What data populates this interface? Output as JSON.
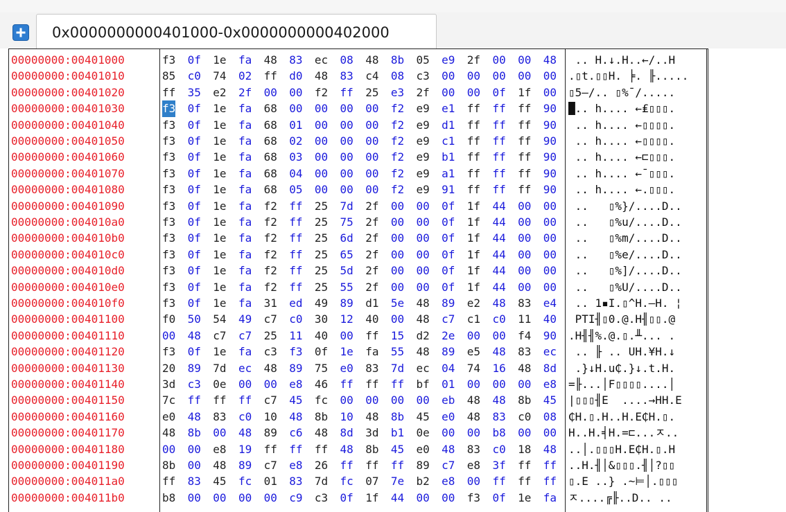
{
  "tabs": {
    "add_button_icon": "plus-icon",
    "active_label": "0x0000000000401000-0x0000000000402000"
  },
  "hex_view": {
    "selected": {
      "row": 3,
      "col": 0
    },
    "colors": {
      "address": "#e8202a",
      "zero_byte": "#1a1adc",
      "byte": "#222222",
      "selection": "#2f7fc9"
    },
    "rows": [
      {
        "address": "00000000:00401000",
        "bytes": [
          "f3",
          "0f",
          "1e",
          "fa",
          "48",
          "83",
          "ec",
          "08",
          "48",
          "8b",
          "05",
          "e9",
          "2f",
          "00",
          "00",
          "48"
        ],
        "ascii": " .. H.↓.H..←/..H"
      },
      {
        "address": "00000000:00401010",
        "bytes": [
          "85",
          "c0",
          "74",
          "02",
          "ff",
          "d0",
          "48",
          "83",
          "c4",
          "08",
          "c3",
          "00",
          "00",
          "00",
          "00",
          "00"
        ],
        "ascii": ".▯t.▯▯H. ╞. ╟....."
      },
      {
        "address": "00000000:00401020",
        "bytes": [
          "ff",
          "35",
          "e2",
          "2f",
          "00",
          "00",
          "f2",
          "ff",
          "25",
          "e3",
          "2f",
          "00",
          "00",
          "0f",
          "1f",
          "00"
        ],
        "ascii": "▯5–/.. ▯%¯/....."
      },
      {
        "address": "00000000:00401030",
        "bytes": [
          "f3",
          "0f",
          "1e",
          "fa",
          "68",
          "00",
          "00",
          "00",
          "00",
          "f2",
          "e9",
          "e1",
          "ff",
          "ff",
          "ff",
          "90"
        ],
        "ascii": "█.. h.... ←₤▯▯▯."
      },
      {
        "address": "00000000:00401040",
        "bytes": [
          "f3",
          "0f",
          "1e",
          "fa",
          "68",
          "01",
          "00",
          "00",
          "00",
          "f2",
          "e9",
          "d1",
          "ff",
          "ff",
          "ff",
          "90"
        ],
        "ascii": " .. h.... ←▯▯▯▯."
      },
      {
        "address": "00000000:00401050",
        "bytes": [
          "f3",
          "0f",
          "1e",
          "fa",
          "68",
          "02",
          "00",
          "00",
          "00",
          "f2",
          "e9",
          "c1",
          "ff",
          "ff",
          "ff",
          "90"
        ],
        "ascii": " .. h.... ←▯▯▯▯."
      },
      {
        "address": "00000000:00401060",
        "bytes": [
          "f3",
          "0f",
          "1e",
          "fa",
          "68",
          "03",
          "00",
          "00",
          "00",
          "f2",
          "e9",
          "b1",
          "ff",
          "ff",
          "ff",
          "90"
        ],
        "ascii": " .. h.... ←⊏▯▯▯."
      },
      {
        "address": "00000000:00401070",
        "bytes": [
          "f3",
          "0f",
          "1e",
          "fa",
          "68",
          "04",
          "00",
          "00",
          "00",
          "f2",
          "e9",
          "a1",
          "ff",
          "ff",
          "ff",
          "90"
        ],
        "ascii": " .. h.... ←¯▯▯▯."
      },
      {
        "address": "00000000:00401080",
        "bytes": [
          "f3",
          "0f",
          "1e",
          "fa",
          "68",
          "05",
          "00",
          "00",
          "00",
          "f2",
          "e9",
          "91",
          "ff",
          "ff",
          "ff",
          "90"
        ],
        "ascii": " .. h.... ←.▯▯▯."
      },
      {
        "address": "00000000:00401090",
        "bytes": [
          "f3",
          "0f",
          "1e",
          "fa",
          "f2",
          "ff",
          "25",
          "7d",
          "2f",
          "00",
          "00",
          "0f",
          "1f",
          "44",
          "00",
          "00"
        ],
        "ascii": " ..   ▯%}/....D.."
      },
      {
        "address": "00000000:004010a0",
        "bytes": [
          "f3",
          "0f",
          "1e",
          "fa",
          "f2",
          "ff",
          "25",
          "75",
          "2f",
          "00",
          "00",
          "0f",
          "1f",
          "44",
          "00",
          "00"
        ],
        "ascii": " ..   ▯%u/....D.."
      },
      {
        "address": "00000000:004010b0",
        "bytes": [
          "f3",
          "0f",
          "1e",
          "fa",
          "f2",
          "ff",
          "25",
          "6d",
          "2f",
          "00",
          "00",
          "0f",
          "1f",
          "44",
          "00",
          "00"
        ],
        "ascii": " ..   ▯%m/....D.."
      },
      {
        "address": "00000000:004010c0",
        "bytes": [
          "f3",
          "0f",
          "1e",
          "fa",
          "f2",
          "ff",
          "25",
          "65",
          "2f",
          "00",
          "00",
          "0f",
          "1f",
          "44",
          "00",
          "00"
        ],
        "ascii": " ..   ▯%e/....D.."
      },
      {
        "address": "00000000:004010d0",
        "bytes": [
          "f3",
          "0f",
          "1e",
          "fa",
          "f2",
          "ff",
          "25",
          "5d",
          "2f",
          "00",
          "00",
          "0f",
          "1f",
          "44",
          "00",
          "00"
        ],
        "ascii": " ..   ▯%]/....D.."
      },
      {
        "address": "00000000:004010e0",
        "bytes": [
          "f3",
          "0f",
          "1e",
          "fa",
          "f2",
          "ff",
          "25",
          "55",
          "2f",
          "00",
          "00",
          "0f",
          "1f",
          "44",
          "00",
          "00"
        ],
        "ascii": " ..   ▯%U/....D.."
      },
      {
        "address": "00000000:004010f0",
        "bytes": [
          "f3",
          "0f",
          "1e",
          "fa",
          "31",
          "ed",
          "49",
          "89",
          "d1",
          "5e",
          "48",
          "89",
          "e2",
          "48",
          "83",
          "e4"
        ],
        "ascii": " .. 1▪I.▯^H.–H. ¦"
      },
      {
        "address": "00000000:00401100",
        "bytes": [
          "f0",
          "50",
          "54",
          "49",
          "c7",
          "c0",
          "30",
          "12",
          "40",
          "00",
          "48",
          "c7",
          "c1",
          "c0",
          "11",
          "40"
        ],
        "ascii": " PTI╢▯0.@.H╢▯▯.@"
      },
      {
        "address": "00000000:00401110",
        "bytes": [
          "00",
          "48",
          "c7",
          "c7",
          "25",
          "11",
          "40",
          "00",
          "ff",
          "15",
          "d2",
          "2e",
          "00",
          "00",
          "f4",
          "90"
        ],
        "ascii": ".H╢╢%.@.▯.╨... ."
      },
      {
        "address": "00000000:00401120",
        "bytes": [
          "f3",
          "0f",
          "1e",
          "fa",
          "c3",
          "f3",
          "0f",
          "1e",
          "fa",
          "55",
          "48",
          "89",
          "e5",
          "48",
          "83",
          "ec"
        ],
        "ascii": " .. ╟ .. UH.¥H.↓"
      },
      {
        "address": "00000000:00401130",
        "bytes": [
          "20",
          "89",
          "7d",
          "ec",
          "48",
          "89",
          "75",
          "e0",
          "83",
          "7d",
          "ec",
          "04",
          "74",
          "16",
          "48",
          "8d"
        ],
        "ascii": " .}↓H.u₵.}↓.t.H."
      },
      {
        "address": "00000000:00401140",
        "bytes": [
          "3d",
          "c3",
          "0e",
          "00",
          "00",
          "e8",
          "46",
          "ff",
          "ff",
          "ff",
          "bf",
          "01",
          "00",
          "00",
          "00",
          "e8"
        ],
        "ascii": "=╟...│F▯▯▯▯....│"
      },
      {
        "address": "00000000:00401150",
        "bytes": [
          "7c",
          "ff",
          "ff",
          "ff",
          "c7",
          "45",
          "fc",
          "00",
          "00",
          "00",
          "00",
          "eb",
          "48",
          "48",
          "8b",
          "45"
        ],
        "ascii": "|▯▯▯╢E  ....→HH.E"
      },
      {
        "address": "00000000:00401160",
        "bytes": [
          "e0",
          "48",
          "83",
          "c0",
          "10",
          "48",
          "8b",
          "10",
          "48",
          "8b",
          "45",
          "e0",
          "48",
          "83",
          "c0",
          "08"
        ],
        "ascii": "₵H.▯.H..H.E₵H.▯."
      },
      {
        "address": "00000000:00401170",
        "bytes": [
          "48",
          "8b",
          "00",
          "48",
          "89",
          "c6",
          "48",
          "8d",
          "3d",
          "b1",
          "0e",
          "00",
          "00",
          "b8",
          "00",
          "00"
        ],
        "ascii": "H..H.╡H.=⊏...ㅈ.."
      },
      {
        "address": "00000000:00401180",
        "bytes": [
          "00",
          "00",
          "e8",
          "19",
          "ff",
          "ff",
          "ff",
          "48",
          "8b",
          "45",
          "e0",
          "48",
          "83",
          "c0",
          "18",
          "48"
        ],
        "ascii": "..│.▯▯▯H.E₵H.▯.H"
      },
      {
        "address": "00000000:00401190",
        "bytes": [
          "8b",
          "00",
          "48",
          "89",
          "c7",
          "e8",
          "26",
          "ff",
          "ff",
          "ff",
          "89",
          "c7",
          "e8",
          "3f",
          "ff",
          "ff"
        ],
        "ascii": "..H.╢│&▯▯▯.╢│?▯▯"
      },
      {
        "address": "00000000:004011a0",
        "bytes": [
          "ff",
          "83",
          "45",
          "fc",
          "01",
          "83",
          "7d",
          "fc",
          "07",
          "7e",
          "b2",
          "e8",
          "00",
          "ff",
          "ff",
          "ff"
        ],
        "ascii": "▯.E ..} .~⊨│.▯▯▯"
      },
      {
        "address": "00000000:004011b0",
        "bytes": [
          "b8",
          "00",
          "00",
          "00",
          "00",
          "c9",
          "c3",
          "0f",
          "1f",
          "44",
          "00",
          "00",
          "f3",
          "0f",
          "1e",
          "fa"
        ],
        "ascii": "ㅈ....╔╟..D.. .. "
      }
    ]
  }
}
